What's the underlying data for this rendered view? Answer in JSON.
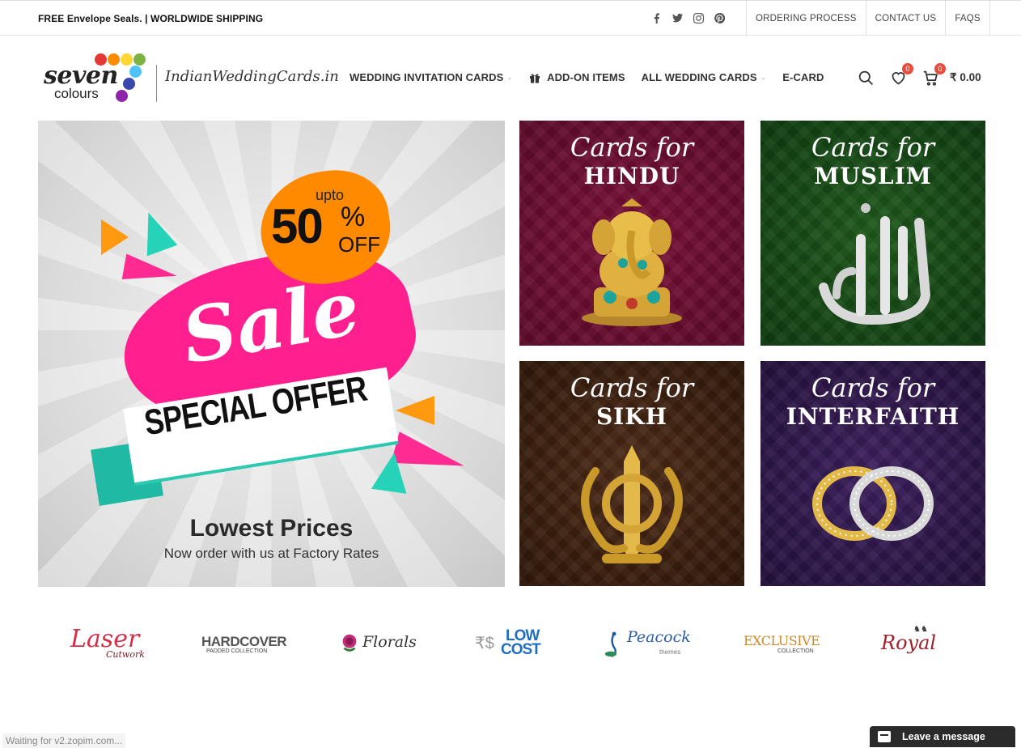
{
  "topbar": {
    "promo": "FREE Envelope Seals. | WORLDWIDE SHIPPING",
    "social": [
      "facebook-icon",
      "twitter-icon",
      "instagram-icon",
      "pinterest-icon"
    ],
    "links": [
      "ORDERING PROCESS",
      "CONTACT US",
      "FAQS"
    ]
  },
  "logo": {
    "word1": "seven",
    "word2": "colours",
    "site": "IndianWeddingCards.in",
    "dot_colors": [
      "#e53935",
      "#fb8c00",
      "#fdd835",
      "#7cb342",
      "#4fc3f7",
      "#3949ab",
      "#8e24aa"
    ]
  },
  "nav": {
    "items": [
      {
        "label": "WEDDING INVITATION CARDS",
        "dropdown": true
      },
      {
        "label": "ADD-ON ITEMS",
        "icon": "gift-icon"
      },
      {
        "label": "ALL WEDDING CARDS",
        "dropdown": true
      },
      {
        "label": "E-CARD"
      }
    ]
  },
  "header_icons": {
    "wishlist_count": "0",
    "cart_count": "0",
    "cart_total": "₹ 0.00"
  },
  "sale_banner": {
    "upto": "upto",
    "discount": "50",
    "percent": "%",
    "off": "OFF",
    "sale": "Sale",
    "special": "SPECIAL OFFER",
    "lowest": "Lowest Prices",
    "sub": "Now order with us at Factory Rates"
  },
  "religion_cards": [
    {
      "cards_for": "Cards for",
      "name": "HINDU"
    },
    {
      "cards_for": "Cards for",
      "name": "MUSLIM"
    },
    {
      "cards_for": "Cards for",
      "name": "SIKH"
    },
    {
      "cards_for": "Cards for",
      "name": "INTERFAITH"
    }
  ],
  "categories": [
    {
      "main": "Laser",
      "sub": "Cutwork"
    },
    {
      "main": "HARDCOVER",
      "sub": "PADDED COLLECTION"
    },
    {
      "main": "Florals"
    },
    {
      "main": "LOW",
      "main2": "COST"
    },
    {
      "main": "Peacock",
      "sub": "themes"
    },
    {
      "main": "EXCLUSIVE",
      "sub": "COLLECTION"
    },
    {
      "main": "Royal"
    }
  ],
  "status_text": "Waiting for v2.zopim.com...",
  "chat_label": "Leave a message",
  "colors": {
    "accent_badge": "#e74c3c",
    "sale_pink": "#ff1f8e",
    "sale_orange": "#ff8a00",
    "sale_teal": "#1fb9a4"
  }
}
